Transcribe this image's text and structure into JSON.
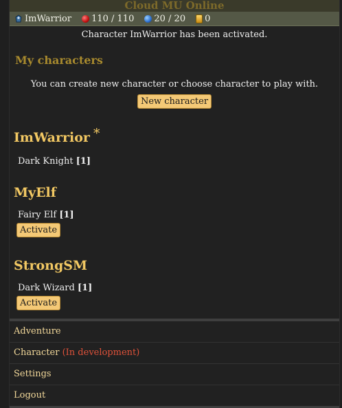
{
  "header": {
    "title": "Cloud MU Online",
    "character": "ImWarrior",
    "hp": "110 / 110",
    "mp": "20 / 20",
    "gold": "0"
  },
  "notice": "Character ImWarrior has been activated.",
  "section": {
    "title": "My characters",
    "intro": "You can create new character or choose character to play with.",
    "new_button": "New character"
  },
  "characters": [
    {
      "name": "ImWarrior",
      "active_marker": "*",
      "class": "Dark Knight",
      "level": "[1]"
    },
    {
      "name": "MyElf",
      "class": "Fairy Elf",
      "level": "[1]",
      "button": "Activate"
    },
    {
      "name": "StrongSM",
      "class": "Dark Wizard",
      "level": "[1]",
      "button": "Activate"
    }
  ],
  "menu": {
    "adventure": "Adventure",
    "character": "Character",
    "character_note": "(In development)",
    "settings": "Settings",
    "logout": "Logout"
  }
}
